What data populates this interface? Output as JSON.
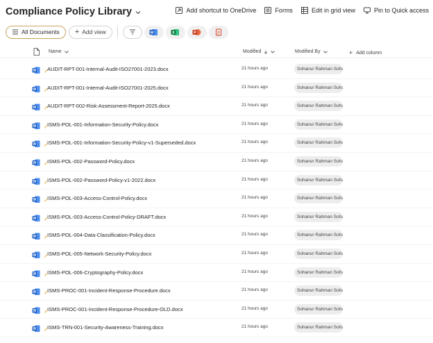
{
  "library": {
    "title": "Compliance Policy Library"
  },
  "header_actions": [
    {
      "label": "Add shortcut to OneDrive",
      "icon": "shortcut-icon"
    },
    {
      "label": "Forms",
      "icon": "forms-icon"
    },
    {
      "label": "Edit in grid view",
      "icon": "grid-icon"
    },
    {
      "label": "Pin to Quick access",
      "icon": "pin-icon"
    }
  ],
  "toolbar": {
    "view_label": "All Documents",
    "add_view_label": "Add view"
  },
  "columns": {
    "name": "Name",
    "modified": "Modified",
    "modified_by": "Modified By",
    "add_column": "Add column"
  },
  "files": [
    {
      "name": "AUDIT-RPT-001-Internal-Audit-ISO27001-2023.docx",
      "modified": "21 hours ago",
      "modified_by": "Sohanur Rahman Sohag"
    },
    {
      "name": "AUDIT-RPT-001-Internal-Audit-ISO27001-2025.docx",
      "modified": "21 hours ago",
      "modified_by": "Sohanur Rahman Sohag"
    },
    {
      "name": "AUDIT-RPT-002-Risk-Assessment-Report-2025.docx",
      "modified": "21 hours ago",
      "modified_by": "Sohanur Rahman Sohag"
    },
    {
      "name": "ISMS-POL-001-Information-Security-Policy.docx",
      "modified": "21 hours ago",
      "modified_by": "Sohanur Rahman Sohag"
    },
    {
      "name": "ISMS-POL-001-Information-Security-Policy-v1-Superseded.docx",
      "modified": "21 hours ago",
      "modified_by": "Sohanur Rahman Sohag"
    },
    {
      "name": "ISMS-POL-002-Password-Policy.docx",
      "modified": "21 hours ago",
      "modified_by": "Sohanur Rahman Sohag"
    },
    {
      "name": "ISMS-POL-002-Password-Policy-v1-2022.docx",
      "modified": "21 hours ago",
      "modified_by": "Sohanur Rahman Sohag"
    },
    {
      "name": "ISMS-POL-003-Access-Control-Policy.docx",
      "modified": "21 hours ago",
      "modified_by": "Sohanur Rahman Sohag"
    },
    {
      "name": "ISMS-POL-003-Access-Control-Policy-DRAFT.docx",
      "modified": "21 hours ago",
      "modified_by": "Sohanur Rahman Sohag"
    },
    {
      "name": "ISMS-POL-004-Data-Classification-Policy.docx",
      "modified": "21 hours ago",
      "modified_by": "Sohanur Rahman Sohag"
    },
    {
      "name": "ISMS-POL-005-Network-Security-Policy.docx",
      "modified": "21 hours ago",
      "modified_by": "Sohanur Rahman Sohag"
    },
    {
      "name": "ISMS-POL-006-Cryptography-Policy.docx",
      "modified": "21 hours ago",
      "modified_by": "Sohanur Rahman Sohag"
    },
    {
      "name": "ISMS-PROC-001-Incident-Response-Procedure.docx",
      "modified": "21 hours ago",
      "modified_by": "Sohanur Rahman Sohag"
    },
    {
      "name": "ISMS-PROC-001-Incident-Response-Procedure-OLD.docx",
      "modified": "21 hours ago",
      "modified_by": "Sohanur Rahman Sohag"
    },
    {
      "name": "ISMS-TRN-001-Security-Awareness-Training.docx",
      "modified": "21 hours ago",
      "modified_by": "Sohanur Rahman Sohag"
    }
  ],
  "colors": {
    "word_blue": "#185abd",
    "accent_border": "#c8a45a",
    "new_marker": "#e3a21a"
  }
}
